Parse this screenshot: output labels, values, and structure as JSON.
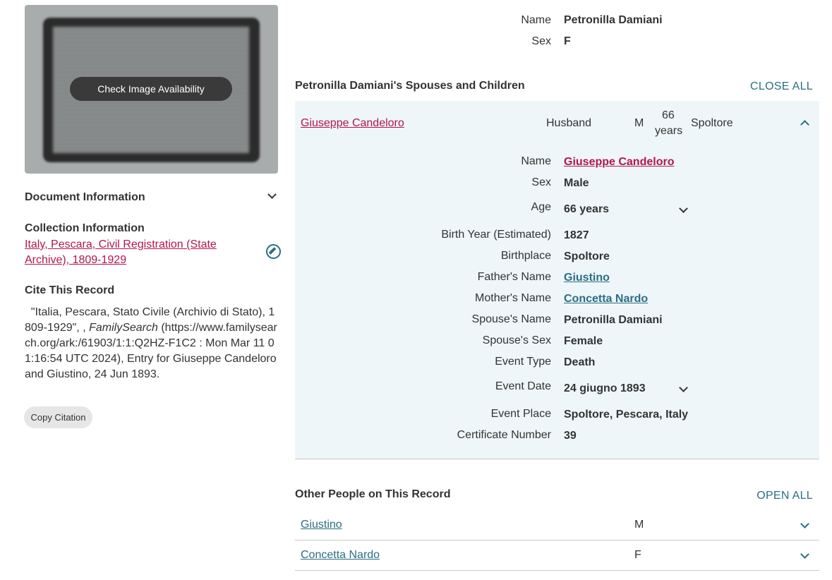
{
  "left": {
    "image_button": "Check Image Availability",
    "document_info": "Document Information",
    "collection_heading": "Collection Information",
    "collection_link": "Italy, Pescara, Civil Registration (State Archive), 1809-1929",
    "cite_heading": "Cite This Record",
    "citation_pre": "\"Italia, Pescara, Stato Civile (Archivio di Stato), 1809-1929\", , ",
    "citation_italic": "FamilySearch",
    "citation_post": " (https://www.familysearch.org/ark:/61903/1:1:Q2HZ-F1C2 : Mon Mar 11 01:16:54 UTC 2024), Entry for Giuseppe Candeloro and Giustino, 24 Jun 1893.",
    "copy_button": "Copy Citation"
  },
  "principal": {
    "name_label": "Name",
    "name_value": "Petronilla Damiani",
    "sex_label": "Sex",
    "sex_value": "F"
  },
  "spouses": {
    "heading": "Petronilla Damiani's Spouses and Children",
    "action": "CLOSE ALL",
    "row": {
      "name": "Giuseppe Candeloro",
      "relation": "Husband",
      "sex": "M",
      "age_line1": "66",
      "age_line2": "years",
      "place": "Spoltore"
    },
    "facts": [
      {
        "label": "Name",
        "value": "Giuseppe Candeloro",
        "style": "link"
      },
      {
        "label": "Sex",
        "value": "Male",
        "style": "plain"
      },
      {
        "label": "Age",
        "value": "66 years",
        "style": "plain",
        "expand": true
      },
      {
        "label": "Birth Year (Estimated)",
        "value": "1827",
        "style": "plain"
      },
      {
        "label": "Birthplace",
        "value": "Spoltore",
        "style": "plain"
      },
      {
        "label": "Father's Name",
        "value": "Giustino",
        "style": "tlink"
      },
      {
        "label": "Mother's Name",
        "value": "Concetta Nardo",
        "style": "tlink"
      },
      {
        "label": "Spouse's Name",
        "value": "Petronilla Damiani",
        "style": "plain"
      },
      {
        "label": "Spouse's Sex",
        "value": "Female",
        "style": "plain"
      },
      {
        "label": "Event Type",
        "value": "Death",
        "style": "plain"
      },
      {
        "label": "Event Date",
        "value": "24 giugno 1893",
        "style": "plain",
        "expand": true
      },
      {
        "label": "Event Place",
        "value": "Spoltore, Pescara, Italy",
        "style": "plain"
      },
      {
        "label": "Certificate Number",
        "value": "39",
        "style": "plain"
      }
    ]
  },
  "others": {
    "heading": "Other People on This Record",
    "action": "OPEN ALL",
    "people": [
      {
        "name": "Giustino",
        "sex": "M"
      },
      {
        "name": "Concetta Nardo",
        "sex": "F"
      }
    ]
  },
  "colors": {
    "link_red": "#b3164e",
    "link_teal": "#2a6f84",
    "panel_bg": "#eef6f9"
  }
}
